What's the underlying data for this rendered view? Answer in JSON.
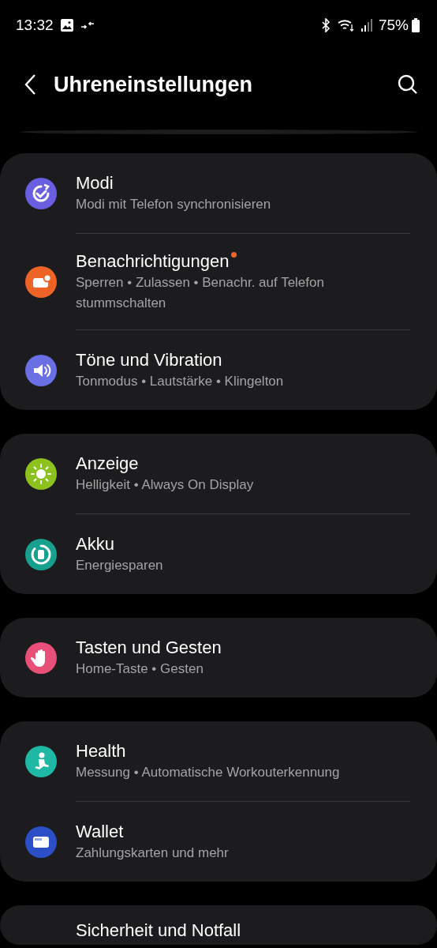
{
  "status_bar": {
    "time": "13:32",
    "battery": "75%"
  },
  "header": {
    "title": "Uhreneinstellungen"
  },
  "groups": [
    {
      "items": [
        {
          "kind": "modes",
          "color": "#6a5fe0",
          "title": "Modi",
          "subtitle": "Modi mit Telefon synchronisieren",
          "badge": false
        },
        {
          "kind": "notifications",
          "color": "#ee6426",
          "title": "Benachrichtigungen",
          "subtitle": "Sperren • Zulassen • Benachr. auf Telefon stummschalten",
          "badge": true
        },
        {
          "kind": "sound",
          "color": "#6b6fe4",
          "title": "Töne und Vibration",
          "subtitle": "Tonmodus • Lautstärke • Klingelton",
          "badge": false
        }
      ]
    },
    {
      "items": [
        {
          "kind": "display",
          "color": "#8cc11e",
          "title": "Anzeige",
          "subtitle": "Helligkeit • Always On Display",
          "badge": false
        },
        {
          "kind": "battery",
          "color": "#16a08e",
          "title": "Akku",
          "subtitle": "Energiesparen",
          "badge": false
        }
      ]
    },
    {
      "items": [
        {
          "kind": "hand",
          "color": "#e8507a",
          "title": "Tasten und Gesten",
          "subtitle": "Home-Taste • Gesten",
          "badge": false
        }
      ]
    },
    {
      "items": [
        {
          "kind": "health",
          "color": "#1fb8a4",
          "title": "Health",
          "subtitle": "Messung • Automatische Workouterkennung",
          "badge": false
        },
        {
          "kind": "wallet",
          "color": "#2c4fc7",
          "title": "Wallet",
          "subtitle": "Zahlungskarten und mehr",
          "badge": false
        }
      ]
    },
    {
      "items": [
        {
          "title": "Sicherheit und Notfall"
        }
      ]
    }
  ]
}
